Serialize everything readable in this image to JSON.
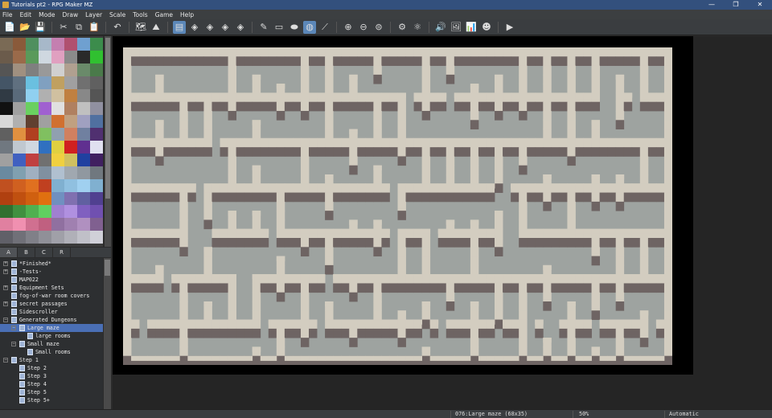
{
  "window": {
    "title": "Tutorials pt2 - RPG Maker MZ",
    "controls": [
      "—",
      "❐",
      "✕"
    ]
  },
  "menu": [
    "File",
    "Edit",
    "Mode",
    "Draw",
    "Layer",
    "Scale",
    "Tools",
    "Game",
    "Help"
  ],
  "toolbar": {
    "groups": [
      [
        {
          "name": "new-project",
          "glyph": "📄"
        },
        {
          "name": "open-project",
          "glyph": "📂"
        },
        {
          "name": "save-project",
          "glyph": "💾"
        }
      ],
      [
        {
          "name": "cut",
          "glyph": "✂"
        },
        {
          "name": "copy",
          "glyph": "⧉"
        },
        {
          "name": "paste",
          "glyph": "📋"
        }
      ],
      [
        {
          "name": "undo",
          "glyph": "↶"
        }
      ],
      [
        {
          "name": "map-mode",
          "glyph": "🗺"
        },
        {
          "name": "event-mode",
          "glyph": "⛰"
        }
      ],
      [
        {
          "name": "layer-auto",
          "glyph": "▤",
          "active": true
        },
        {
          "name": "layer-1",
          "glyph": "◈"
        },
        {
          "name": "layer-2",
          "glyph": "◈"
        },
        {
          "name": "layer-3",
          "glyph": "◈"
        },
        {
          "name": "layer-4",
          "glyph": "◈"
        }
      ],
      [
        {
          "name": "pencil",
          "glyph": "✎"
        },
        {
          "name": "rectangle",
          "glyph": "▭"
        },
        {
          "name": "ellipse",
          "glyph": "⬬"
        },
        {
          "name": "fill",
          "glyph": "◍",
          "active": true
        },
        {
          "name": "shadow-pen",
          "glyph": "⟋"
        }
      ],
      [
        {
          "name": "zoom-in",
          "glyph": "⊕"
        },
        {
          "name": "zoom-out",
          "glyph": "⊖"
        },
        {
          "name": "zoom-actual",
          "glyph": "⊜"
        }
      ],
      [
        {
          "name": "database",
          "glyph": "⚙"
        },
        {
          "name": "plugin-manager",
          "glyph": "⚛"
        }
      ],
      [
        {
          "name": "sound-test",
          "glyph": "🔊"
        },
        {
          "name": "event-searcher",
          "glyph": "🖼"
        },
        {
          "name": "resource-manager",
          "glyph": "📊"
        },
        {
          "name": "character-generator",
          "glyph": "☻"
        }
      ],
      [
        {
          "name": "playtest",
          "glyph": "▶"
        }
      ]
    ]
  },
  "tileset_tabs": [
    {
      "label": "A",
      "active": true
    },
    {
      "label": "B",
      "active": false
    },
    {
      "label": "C",
      "active": false
    },
    {
      "label": "R",
      "active": false
    }
  ],
  "map_tree": [
    {
      "label": "*Finished*",
      "indent": 0,
      "expander": "+",
      "selected": false
    },
    {
      "label": "-Tests-",
      "indent": 0,
      "expander": "+",
      "selected": false
    },
    {
      "label": "MAP022",
      "indent": 0,
      "expander": "",
      "selected": false
    },
    {
      "label": "Equipment Sets",
      "indent": 0,
      "expander": "+",
      "selected": false
    },
    {
      "label": "fog-of-war room covers",
      "indent": 0,
      "expander": "",
      "selected": false
    },
    {
      "label": "secret passages",
      "indent": 0,
      "expander": "+",
      "selected": false
    },
    {
      "label": "Sidescroller",
      "indent": 0,
      "expander": "",
      "selected": false
    },
    {
      "label": "Generated Dungeons",
      "indent": 0,
      "expander": "−",
      "selected": false
    },
    {
      "label": "Large maze",
      "indent": 1,
      "expander": "−",
      "selected": true
    },
    {
      "label": "large rooms",
      "indent": 2,
      "expander": "",
      "selected": false
    },
    {
      "label": "Small maze",
      "indent": 1,
      "expander": "−",
      "selected": false
    },
    {
      "label": "Small rooms",
      "indent": 2,
      "expander": "",
      "selected": false
    },
    {
      "label": "Step 1",
      "indent": 0,
      "expander": "−",
      "selected": false
    },
    {
      "label": "Step 2",
      "indent": 1,
      "expander": "",
      "selected": false
    },
    {
      "label": "Step 3",
      "indent": 1,
      "expander": "",
      "selected": false
    },
    {
      "label": "Step 4",
      "indent": 1,
      "expander": "",
      "selected": false
    },
    {
      "label": "Step 5",
      "indent": 1,
      "expander": "",
      "selected": false
    },
    {
      "label": "Step 5+",
      "indent": 1,
      "expander": "",
      "selected": false
    }
  ],
  "status": {
    "map_info": "076:Large maze (68x35)",
    "zoom": "50%",
    "mode": "Automatic"
  },
  "colors": {
    "floor": "#9ea3a0",
    "wall_top": "#d3cdc0",
    "wall_face": "#6e6463",
    "accent": "#4a6fb5"
  }
}
